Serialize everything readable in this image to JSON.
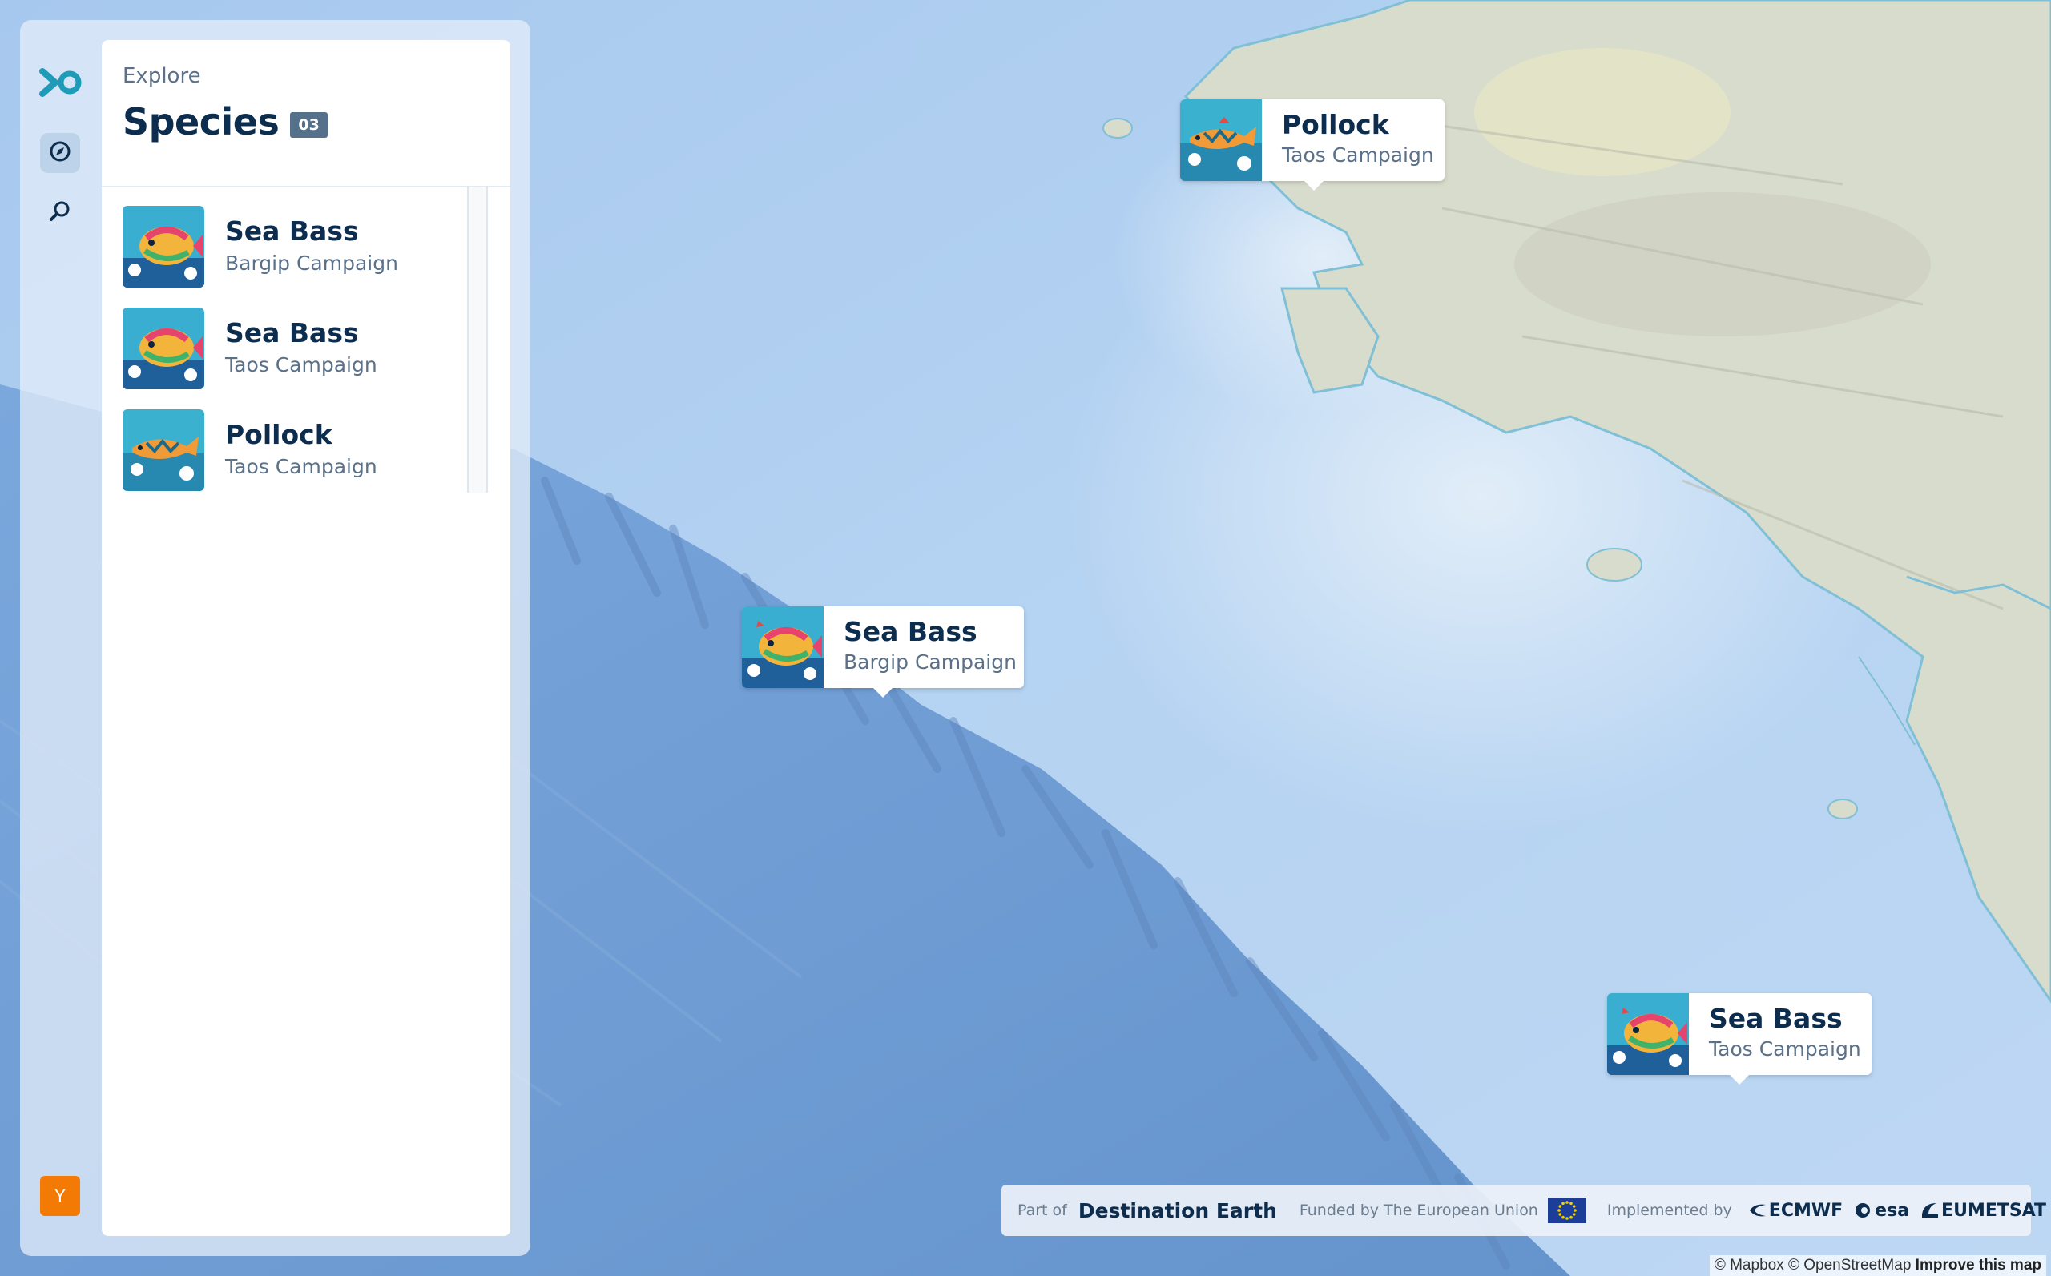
{
  "sidebar": {
    "eyebrow": "Explore",
    "title": "Species",
    "count": "03",
    "avatar_initial": "Y",
    "rail_icons": [
      "logo-icon",
      "compass-icon",
      "search-icon"
    ],
    "items": [
      {
        "name": "Sea Bass",
        "campaign": "Bargip Campaign",
        "image": "sea-bass"
      },
      {
        "name": "Sea Bass",
        "campaign": "Taos Campaign",
        "image": "sea-bass"
      },
      {
        "name": "Pollock",
        "campaign": "Taos Campaign",
        "image": "pollock"
      }
    ]
  },
  "map": {
    "markers": [
      {
        "name": "Pollock",
        "campaign": "Taos Campaign",
        "image": "pollock"
      },
      {
        "name": "Sea Bass",
        "campaign": "Bargip Campaign",
        "image": "sea-bass"
      },
      {
        "name": "Sea Bass",
        "campaign": "Taos Campaign",
        "image": "sea-bass"
      }
    ],
    "colors": {
      "deep_sea": "#6f9fd6",
      "shelf_sea": "#b4d2f1",
      "land": "#d9dccd",
      "coast": "#7fc0d6"
    }
  },
  "footer": {
    "part_of": "Part of",
    "destination": "Destination Earth",
    "funded_by": "Funded by The European Union",
    "implemented_by": "Implemented by",
    "orgs": [
      "ECMWF",
      "esa",
      "EUMETSAT"
    ],
    "close_symbol": "✕"
  },
  "attribution": {
    "text": "© Mapbox © OpenStreetMap",
    "improve": "Improve this map"
  }
}
